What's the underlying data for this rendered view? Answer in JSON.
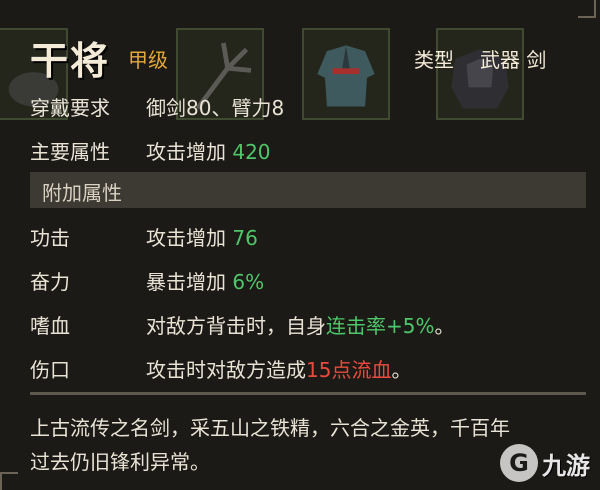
{
  "item": {
    "name": "干将",
    "grade": "甲级",
    "type_label": "类型",
    "type_value": "武器 剑"
  },
  "requirement": {
    "label": "穿戴要求",
    "value": "御剑80、臂力8"
  },
  "main_attr": {
    "label": "主要属性",
    "text": "攻击增加 ",
    "value": "420"
  },
  "extra_header": "附加属性",
  "extras": [
    {
      "label": "功击",
      "text": "攻击增加 ",
      "value": "76"
    },
    {
      "label": "奋力",
      "text": "暴击增加 ",
      "value": "6%"
    },
    {
      "label": "嗜血",
      "pre": "对敌方背击时，自身",
      "highlight": "连击率+5%",
      "post": "。"
    },
    {
      "label": "伤口",
      "pre": "攻击时对敌方造成",
      "highlight": "15点流血",
      "post": "。"
    }
  ],
  "description": {
    "line1": "上古流传之名剑，采五山之铁精，六合之金英，千百年",
    "line2": "过去仍旧锋利异常。"
  },
  "watermark": {
    "logo": "G",
    "text": "九游"
  },
  "colors": {
    "grade": "#e4a83a",
    "positive": "#4ec76a",
    "bleed": "#e84a3e",
    "header_bg": "#3d3a33"
  },
  "icons": [
    "fork-icon",
    "robe-icon",
    "armor-icon"
  ]
}
